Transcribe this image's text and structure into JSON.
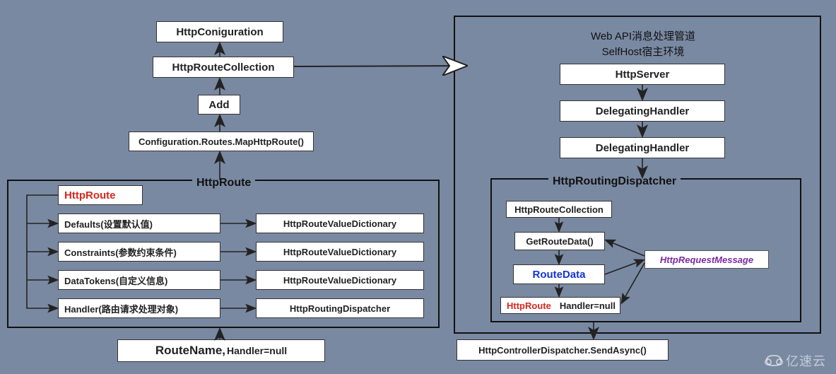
{
  "left": {
    "top1": "HttpConiguration",
    "top2": "HttpRouteCollection",
    "top3": "Add",
    "top4": "Configuration.Routes.MapHttpRoute()",
    "frame_title": "HttpRoute",
    "items": [
      {
        "label": "HttpRoute",
        "target": ""
      },
      {
        "label": "Defaults(设置默认值)",
        "target": "HttpRouteValueDictionary"
      },
      {
        "label": "Constraints(参数约束条件)",
        "target": "HttpRouteValueDictionary"
      },
      {
        "label": "DataTokens(自定义信息)",
        "target": "HttpRouteValueDictionary"
      },
      {
        "label": "Handler(路由请求处理对象)",
        "target": "HttpRoutingDispatcher"
      }
    ],
    "bottom_route": "RouteName,",
    "bottom_handler": "Handler=null"
  },
  "right": {
    "title_line1": "Web API消息处理管道",
    "title_line2": "SelfHost宿主环境",
    "chain": [
      "HttpServer",
      "DelegatingHandler",
      "DelegatingHandler"
    ],
    "dispatcher_title": "HttpRoutingDispatcher",
    "inner": {
      "a": "HttpRouteCollection",
      "b": "GetRouteData()",
      "c": "RouteData",
      "d_left": "HttpRoute",
      "d_right": "Handler=null"
    },
    "request_msg": "HttpRequestMessage",
    "bottom": "HttpControllerDispatcher.SendAsync()"
  },
  "watermark": "亿速云"
}
